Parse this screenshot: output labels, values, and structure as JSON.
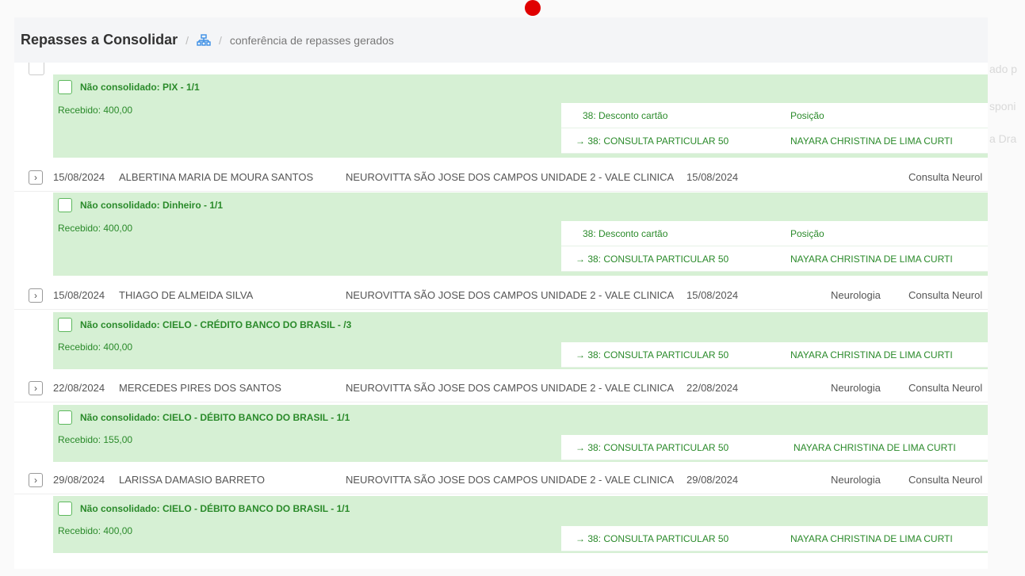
{
  "header": {
    "title": "Repasses a Consolidar",
    "separator": "/",
    "crumb": "conferência de repasses gerados"
  },
  "icons": {
    "home": "sitemap-home-icon",
    "expand": "chevron-right-icon",
    "arrow": "arrow-right-icon"
  },
  "colors": {
    "accent_green": "#2a8a2a",
    "block_bg": "#d6f0d4",
    "record_dot": "#e00000"
  },
  "ghost_text": [
    "ado p",
    "sponi",
    "a Dra"
  ],
  "blocks": [
    {
      "status": "Não consolidado: PIX - 1/1",
      "received": "Recebido: 400,00",
      "panel_rows": [
        {
          "left": "38: Desconto cartão",
          "right": "Posição"
        },
        {
          "left": "→  38: CONSULTA PARTICULAR 50",
          "right": "NAYARA CHRISTINA DE LIMA CURTI"
        }
      ]
    },
    {
      "row": {
        "date": "15/08/2024",
        "patient": "ALBERTINA MARIA DE MOURA SANTOS",
        "clinic": "NEUROVITTA SÃO JOSE DOS CAMPOS UNIDADE 2 - VALE CLINICA",
        "date2": "15/08/2024",
        "specialty": "",
        "service": "Consulta Neurol"
      },
      "status": "Não consolidado: Dinheiro - 1/1",
      "received": "Recebido: 400,00",
      "panel_rows": [
        {
          "left": "38: Desconto cartão",
          "right": "Posição"
        },
        {
          "left": "→  38: CONSULTA PARTICULAR 50",
          "right": "NAYARA CHRISTINA DE LIMA CURTI"
        }
      ]
    },
    {
      "row": {
        "date": "15/08/2024",
        "patient": "THIAGO DE ALMEIDA SILVA",
        "clinic": "NEUROVITTA SÃO JOSE DOS CAMPOS UNIDADE 2 - VALE CLINICA",
        "date2": "15/08/2024",
        "specialty": "Neurologia",
        "service": "Consulta Neurol"
      },
      "status": "Não consolidado: CIELO - CRÉDITO BANCO DO BRASIL - /3",
      "received": "Recebido: 400,00",
      "panel_rows": [
        {
          "left": "→  38: CONSULTA PARTICULAR 50",
          "right": "NAYARA CHRISTINA DE LIMA CURTI"
        }
      ]
    },
    {
      "row": {
        "date": "22/08/2024",
        "patient": "MERCEDES PIRES DOS SANTOS",
        "clinic": "NEUROVITTA SÃO JOSE DOS CAMPOS UNIDADE 2 - VALE CLINICA",
        "date2": "22/08/2024",
        "specialty": "Neurologia",
        "service": "Consulta Neurol"
      },
      "status": "Não consolidado: CIELO - DÉBITO BANCO DO BRASIL - 1/1",
      "received": "Recebido: 155,00",
      "panel_rows": [
        {
          "left": "→  38: CONSULTA PARTICULAR 50",
          "right": "NAYARA CHRISTINA DE LIMA CURTI"
        }
      ]
    },
    {
      "row": {
        "date": "29/08/2024",
        "patient": "LARISSA DAMASIO BARRETO",
        "clinic": "NEUROVITTA SÃO JOSE DOS CAMPOS UNIDADE 2 - VALE CLINICA",
        "date2": "29/08/2024",
        "specialty": "Neurologia",
        "service": "Consulta Neurol"
      },
      "status": "Não consolidado: CIELO - DÉBITO BANCO DO BRASIL - 1/1",
      "received": "Recebido: 400,00",
      "panel_rows": [
        {
          "left": "→  38: CONSULTA PARTICULAR 50",
          "right": "NAYARA CHRISTINA DE LIMA CURTI"
        }
      ]
    }
  ]
}
